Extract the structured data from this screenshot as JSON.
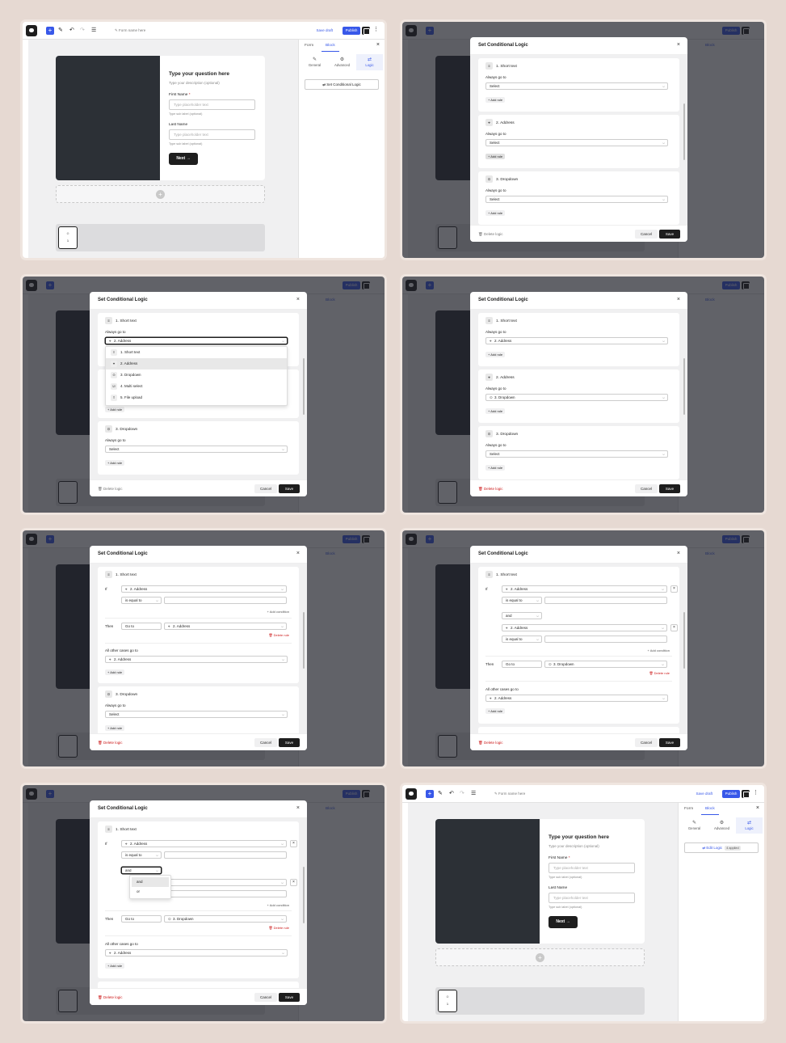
{
  "toolbar": {
    "form_name": "Form name here",
    "save_draft": "Save draft",
    "publish": "Publish"
  },
  "form": {
    "question": "Type your question here",
    "description": "Type your description (optional)",
    "first_name_label": "First Name",
    "required_mark": "*",
    "last_name_label": "Last Name",
    "placeholder": "Type placeholder text",
    "sub_label": "Type sub label (optional)",
    "next": "Next",
    "thumb_num": "1"
  },
  "sidebar": {
    "tab_form": "Form",
    "tab_block": "Block",
    "tabs": [
      "General",
      "Advanced",
      "Logic"
    ],
    "set_logic": "Set Conditional Logic",
    "edit_logic": "Edit Logic",
    "applied": "4 applied"
  },
  "modal": {
    "title": "Set Conditional Logic",
    "delete": "Delete logic",
    "cancel": "Cancel",
    "save": "Save",
    "always": "Always go to",
    "select": "Select",
    "add_rule": "Add rule",
    "if": "If",
    "then": "Then",
    "go_to": "Go to",
    "is_equal": "is equal to",
    "and": "and",
    "or": "or",
    "add_condition": "Add condition",
    "delete_rule": "Delete rule",
    "others": "All other cases go to"
  },
  "blocks": [
    "1. Short text",
    "2. Address",
    "3. Dropdown",
    "4. Multi select",
    "5. File upload"
  ],
  "colors": {
    "accent": "#3858e9",
    "dark": "#1e1e1e",
    "danger": "#cc1818",
    "backdrop": "#e6d9d2"
  }
}
